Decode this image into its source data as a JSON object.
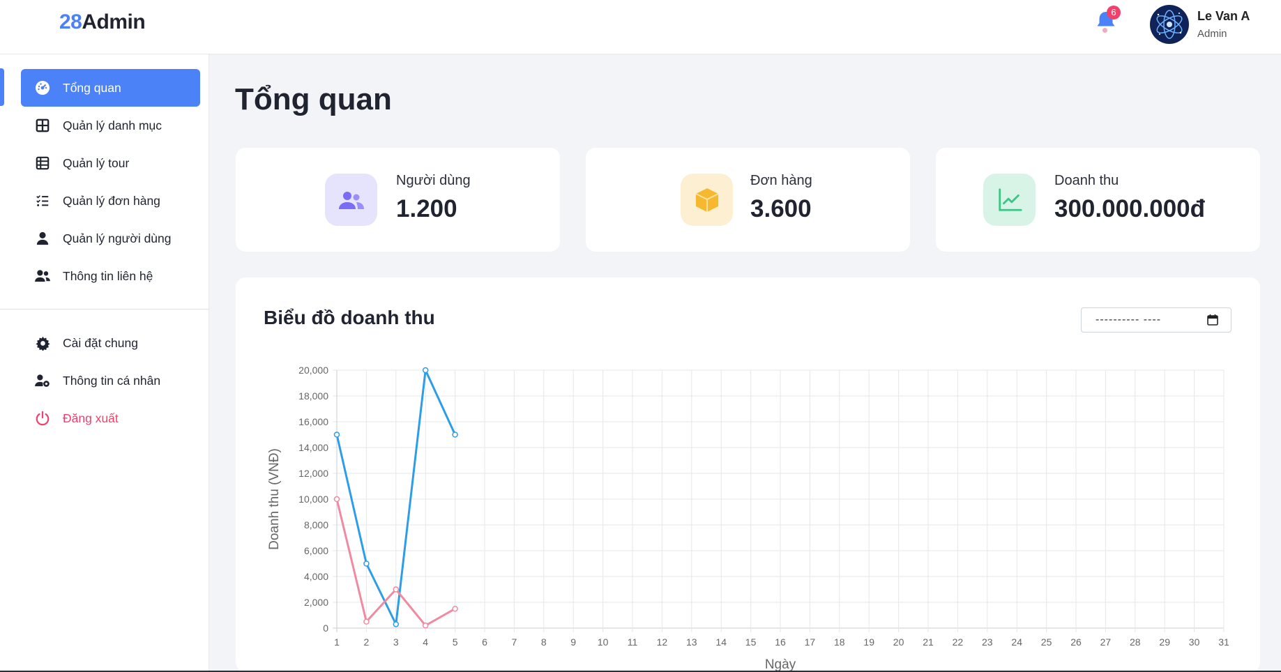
{
  "brand": {
    "prefix": "28",
    "suffix": "Admin"
  },
  "header": {
    "notification_count": "6",
    "user_name": "Le Van A",
    "user_role": "Admin"
  },
  "sidebar": {
    "items": [
      {
        "label": "Tổng quan",
        "icon": "dashboard-icon",
        "active": true
      },
      {
        "label": "Quản lý danh mục",
        "icon": "grid-icon"
      },
      {
        "label": "Quản lý tour",
        "icon": "table-icon"
      },
      {
        "label": "Quản lý đơn hàng",
        "icon": "checklist-icon"
      },
      {
        "label": "Quản lý người dùng",
        "icon": "user-icon"
      },
      {
        "label": "Thông tin liên hệ",
        "icon": "users-icon"
      }
    ],
    "secondary": [
      {
        "label": "Cài đặt chung",
        "icon": "gear-icon"
      },
      {
        "label": "Thông tin cá nhân",
        "icon": "user-gear-icon"
      },
      {
        "label": "Đăng xuất",
        "icon": "power-icon"
      }
    ]
  },
  "page_title": "Tổng quan",
  "stats": [
    {
      "label": "Người dùng",
      "value": "1.200",
      "icon": "users-icon",
      "color": "#7b6cf6"
    },
    {
      "label": "Đơn hàng",
      "value": "3.600",
      "icon": "box-icon",
      "color": "#f5b82e"
    },
    {
      "label": "Doanh thu",
      "value": "300.000.000đ",
      "icon": "chart-line-icon",
      "color": "#3cc587"
    }
  ],
  "chart_section": {
    "title": "Biểu đồ doanh thu",
    "date_placeholder": "---------- ----"
  },
  "colors": {
    "accent": "#4c82f7",
    "danger": "#f0416c",
    "series_blue": "#2e9de8",
    "series_pink": "#f08aa0"
  },
  "chart_data": {
    "type": "line",
    "title": "",
    "xlabel": "Ngày",
    "ylabel": "Doanh thu (VNĐ)",
    "x": [
      1,
      2,
      3,
      4,
      5,
      6,
      7,
      8,
      9,
      10,
      11,
      12,
      13,
      14,
      15,
      16,
      17,
      18,
      19,
      20,
      21,
      22,
      23,
      24,
      25,
      26,
      27,
      28,
      29,
      30,
      31
    ],
    "ylim": [
      0,
      20000
    ],
    "yticks": [
      "0",
      "2,000",
      "4,000",
      "6,000",
      "8,000",
      "10,000",
      "12,000",
      "14,000",
      "16,000",
      "18,000",
      "20,000"
    ],
    "grid": true,
    "legend": "none",
    "series": [
      {
        "color": "#2e9de8",
        "x": [
          1,
          2,
          3,
          4,
          5
        ],
        "values": [
          15000,
          5000,
          300,
          20000,
          15000
        ]
      },
      {
        "color": "#f08aa0",
        "x": [
          1,
          2,
          3,
          4,
          5
        ],
        "values": [
          10000,
          500,
          3000,
          200,
          1500
        ]
      }
    ]
  }
}
